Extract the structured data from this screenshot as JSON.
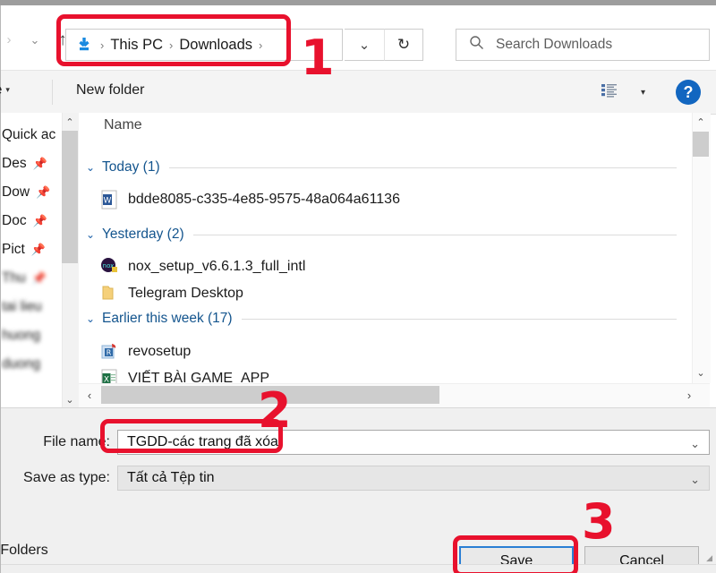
{
  "window": {
    "kind": "save-as-dialog"
  },
  "nav": {
    "forward_icon": "chevron-right-icon",
    "history_icon": "chevron-down-icon",
    "up_icon": "arrow-up-icon",
    "refresh_icon": "refresh-icon",
    "address_dropdown_icon": "chevron-down-icon",
    "breadcrumb": {
      "location_icon": "downloads-arrow-icon",
      "separator": "›",
      "items": [
        "This PC",
        "Downloads"
      ],
      "trailing_separator": "›"
    },
    "search": {
      "icon": "search-icon",
      "placeholder": "Search Downloads"
    }
  },
  "toolbar": {
    "organize_label": "nize",
    "organize_caret": "▾",
    "new_folder_label": "New folder",
    "view_icon": "list-view-icon",
    "view_caret": "▾",
    "help_icon": "help-question-icon",
    "help_label": "?"
  },
  "sidebar": {
    "scroll_up_icon": "chevron-up-icon",
    "scroll_down_icon": "chevron-down-icon",
    "items": [
      {
        "label": "Quick ac",
        "icon": "star-icon",
        "pinned": false,
        "blurred": false
      },
      {
        "label": "Des",
        "icon": "desktop-icon",
        "pinned": true,
        "pin_icon": "pin-icon",
        "blurred": false
      },
      {
        "label": "Dow",
        "icon": "downloads-icon",
        "pinned": true,
        "pin_icon": "pin-icon",
        "blurred": false
      },
      {
        "label": "Doc",
        "icon": "documents-icon",
        "pinned": true,
        "pin_icon": "pin-icon",
        "blurred": false
      },
      {
        "label": "Pict",
        "icon": "pictures-icon",
        "pinned": true,
        "pin_icon": "pin-icon",
        "blurred": false
      },
      {
        "label": "Thu",
        "icon": "folder-icon",
        "pinned": true,
        "pin_icon": "pin-icon",
        "blurred": true
      },
      {
        "label": "tai lieu",
        "icon": "folder-icon",
        "pinned": false,
        "blurred": true
      },
      {
        "label": "huong",
        "icon": "folder-icon",
        "pinned": false,
        "blurred": true
      },
      {
        "label": "duong",
        "icon": "folder-icon",
        "pinned": false,
        "blurred": true
      }
    ]
  },
  "filelist": {
    "column_header": "Name",
    "groups": [
      {
        "chevron_icon": "chevron-down-icon",
        "label": "Today (1)",
        "files": [
          {
            "name": "bdde8085-c335-4e85-9575-48a064a61136",
            "icon": "word-document-icon"
          }
        ]
      },
      {
        "chevron_icon": "chevron-down-icon",
        "label": "Yesterday (2)",
        "files": [
          {
            "name": "nox_setup_v6.6.1.3_full_intl",
            "icon": "nox-player-icon"
          },
          {
            "name": "Telegram Desktop",
            "icon": "folder-icon"
          }
        ]
      },
      {
        "chevron_icon": "chevron-down-icon",
        "label": "Earlier this week (17)",
        "files": [
          {
            "name": "revosetup",
            "icon": "revo-uninstaller-icon"
          },
          {
            "name": "VIẾT BÀI GAME_APP",
            "icon": "excel-document-icon"
          }
        ]
      }
    ],
    "scroll_up_icon": "chevron-up-icon",
    "scroll_down_icon": "chevron-down-icon",
    "scroll_left_icon": "chevron-left-icon",
    "scroll_right_icon": "chevron-right-icon"
  },
  "form": {
    "file_name_label": "File name:",
    "file_name_value": "TGDD-các trang đã xóa",
    "file_name_caret": "chevron-down-icon",
    "save_as_type_label": "Save as type:",
    "save_as_type_value": "Tất cả Tệp tin",
    "save_as_type_caret": "chevron-down-icon",
    "hide_folders_label": "e Folders",
    "save_button": "Save",
    "cancel_button": "Cancel"
  },
  "annotations": {
    "colors": {
      "red": "#e8112d",
      "focus_blue": "#2a7fd4",
      "accent_blue": "#1266c0"
    },
    "markers": [
      {
        "number": "1",
        "target": "address-bar"
      },
      {
        "number": "2",
        "target": "file-name-field"
      },
      {
        "number": "3",
        "target": "save-button"
      }
    ]
  }
}
